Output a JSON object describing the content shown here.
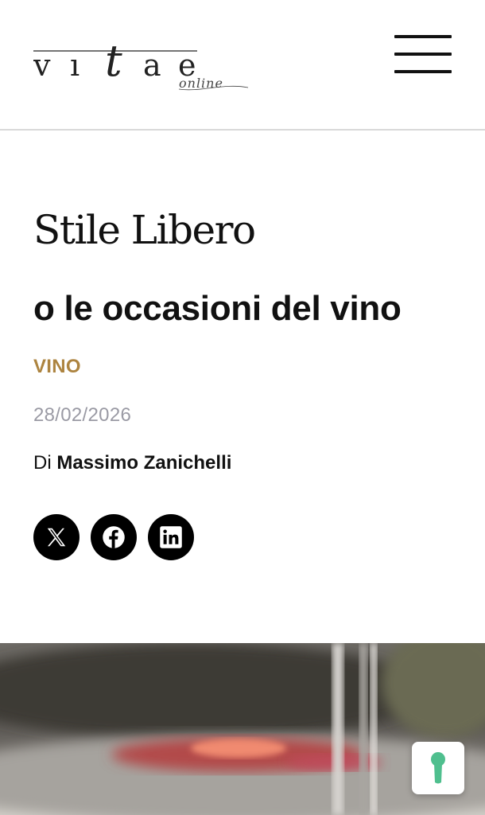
{
  "header": {
    "logo_text": "vitae online",
    "menu_label": "menu"
  },
  "article": {
    "title": "Stile Libero",
    "subtitle": "o le occasioni del vino",
    "category": "VINO",
    "date": "28/02/2026",
    "author_prefix": "Di",
    "author_name": "Massimo Zanichelli"
  },
  "share": {
    "items": [
      {
        "icon": "x-twitter-icon"
      },
      {
        "icon": "facebook-icon"
      },
      {
        "icon": "linkedin-icon"
      }
    ]
  },
  "colors": {
    "category": "#ad8440",
    "date": "#9a9aa4",
    "privacy_icon": "#4fbf8e"
  }
}
